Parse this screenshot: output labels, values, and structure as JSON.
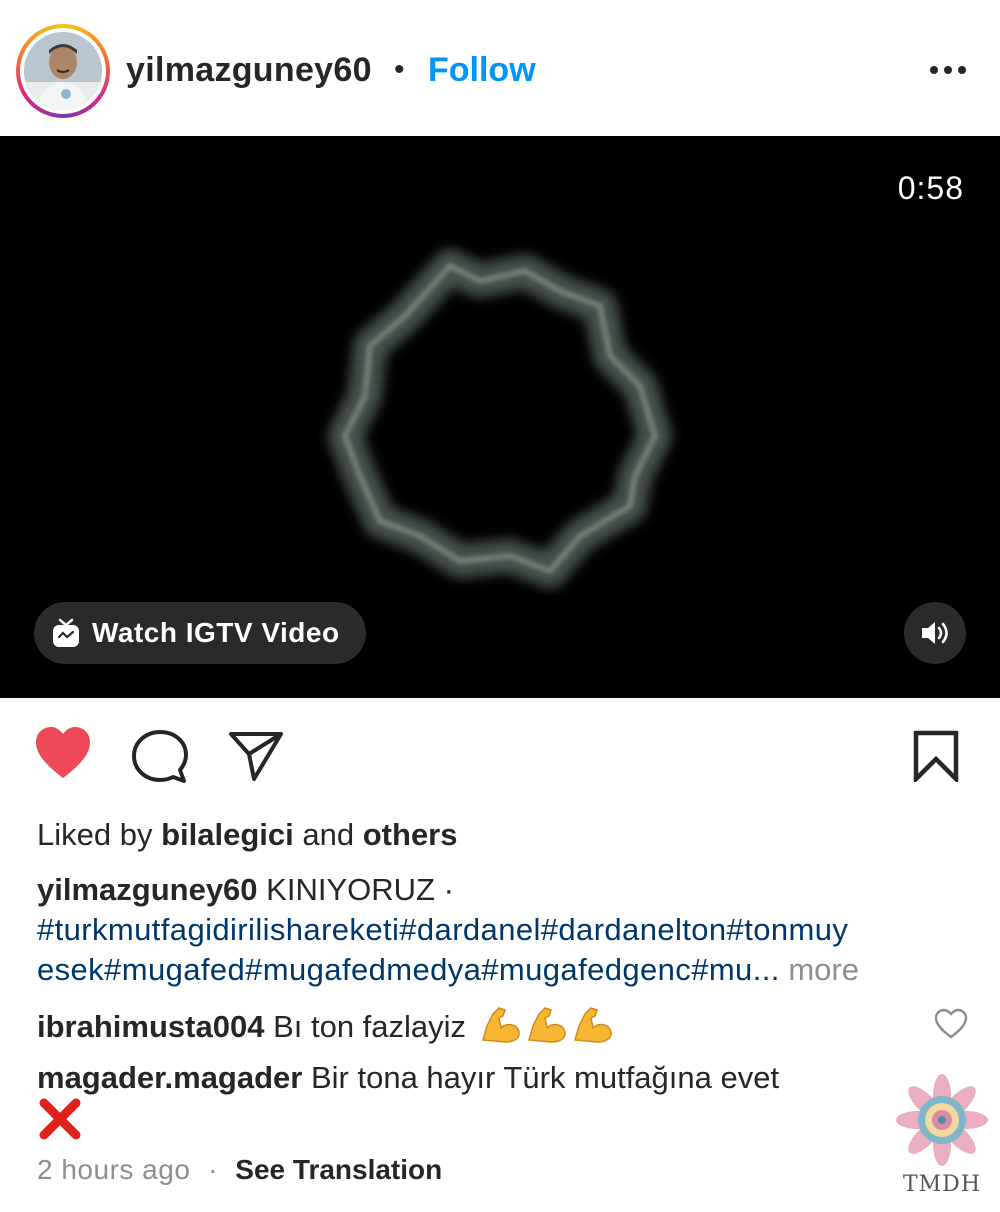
{
  "header": {
    "username": "yilmazguney60",
    "separator": "•",
    "follow_label": "Follow"
  },
  "video": {
    "duration": "0:58",
    "watch_label": "Watch IGTV Video",
    "sound_icon": "speaker-icon"
  },
  "actions": {
    "like_icon": "heart-filled-icon",
    "like_color": "#ed4956",
    "comment_icon": "comment-icon",
    "share_icon": "paper-plane-icon",
    "save_icon": "bookmark-icon"
  },
  "likes": {
    "prefix": "Liked by",
    "user": "bilalegici",
    "and": "and",
    "others": "others"
  },
  "caption": {
    "author": "yilmazguney60",
    "text": "KINIYORUZ ·",
    "hashtags_line1": "#turkmutfagidirilishareketi#dardanel#dardanelton#tonmuy",
    "hashtags_line2": "esek#mugafed#mugafedmedya#mugafedgenc#mu...",
    "more_label": "more"
  },
  "comments": [
    {
      "user": "ibrahimusta004",
      "text": "Bı ton fazlayiz",
      "emoji": "💪💪💪"
    },
    {
      "user": "magader.magader",
      "text": "Bir tona hayır Türk mutfağına evet",
      "emoji": "❌"
    }
  ],
  "meta": {
    "time": "2 hours ago",
    "dot": "·",
    "see_translation": "See Translation"
  },
  "watermark": {
    "text": "TMDH"
  },
  "colors": {
    "follow_blue": "#0095f6",
    "hashtag_blue": "#00376b",
    "muted_gray": "#8e8e8e"
  }
}
